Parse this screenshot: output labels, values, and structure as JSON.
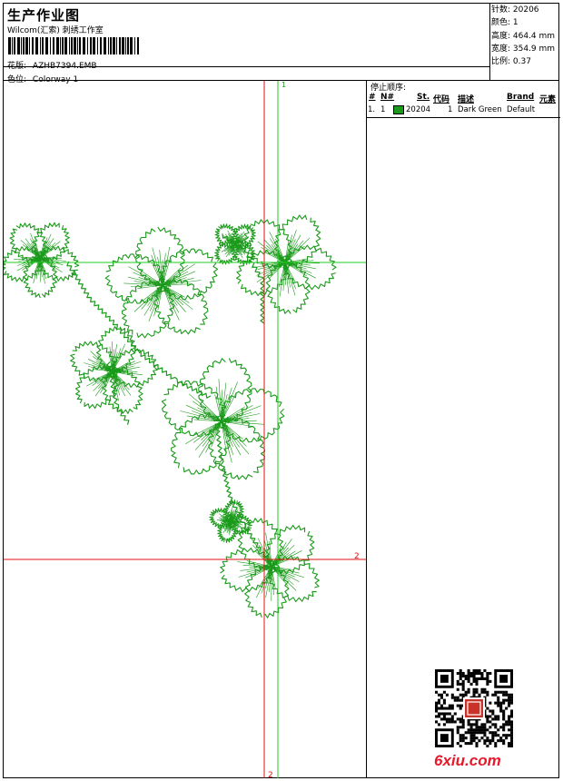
{
  "header": {
    "title": "生产作业图",
    "company": "Wilcom(汇索) 刺绣工作室",
    "design_label": "花版:",
    "design_file": "AZHB7394.EMB",
    "colorway_label": "色位:",
    "colorway": "Colorway 1"
  },
  "stats": {
    "stitches": "针数: 20206",
    "colors": "颜色: 1",
    "height": "高度: 464.4 mm",
    "width": "宽度: 354.9 mm",
    "scale": "比例: 0.37"
  },
  "stop_sequence": {
    "title": "停止顺序:",
    "columns": [
      "#",
      "N#",
      "St.",
      "代码",
      "描述",
      "Brand",
      "元素"
    ],
    "rows": [
      {
        "index": "1.",
        "needle": "1",
        "code": "20204",
        "stitches": "1",
        "description": "Dark Green",
        "brand": "Default",
        "color": "#1a9a1a"
      }
    ]
  },
  "guides": {
    "green_label": "1",
    "red_h_label": "2",
    "red_v_label": "2"
  },
  "watermark": "6xiu.com",
  "colors": {
    "thread": "#1a9a1a",
    "guide_red": "#e01010",
    "guide_green": "#22cc22"
  }
}
